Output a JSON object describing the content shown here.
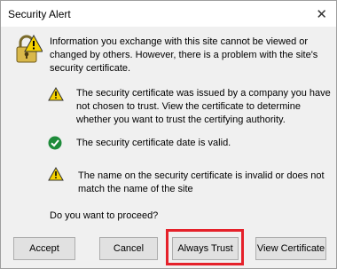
{
  "window": {
    "title": "Security Alert",
    "close_glyph": "✕"
  },
  "intro": "Information you exchange with this site cannot be viewed or changed by others. However, there is a problem with the site's security certificate.",
  "items": [
    {
      "icon": "warning-icon",
      "text": "The security certificate was issued by a company you have not chosen to trust. View the certificate to determine whether you want to trust the certifying authority."
    },
    {
      "icon": "check-icon",
      "text": "The security certificate date is valid."
    },
    {
      "icon": "warning-icon",
      "text": "The name on the security certificate is invalid or does not match the name of the site"
    }
  ],
  "proceed_text": "Do you want to proceed?",
  "buttons": {
    "accept": "Accept",
    "cancel": "Cancel",
    "always_trust": "Always Trust",
    "view_certificate": "View Certificate"
  },
  "colors": {
    "warning": "#f5d100",
    "check": "#1e8b3a",
    "highlight": "#e5212a"
  }
}
